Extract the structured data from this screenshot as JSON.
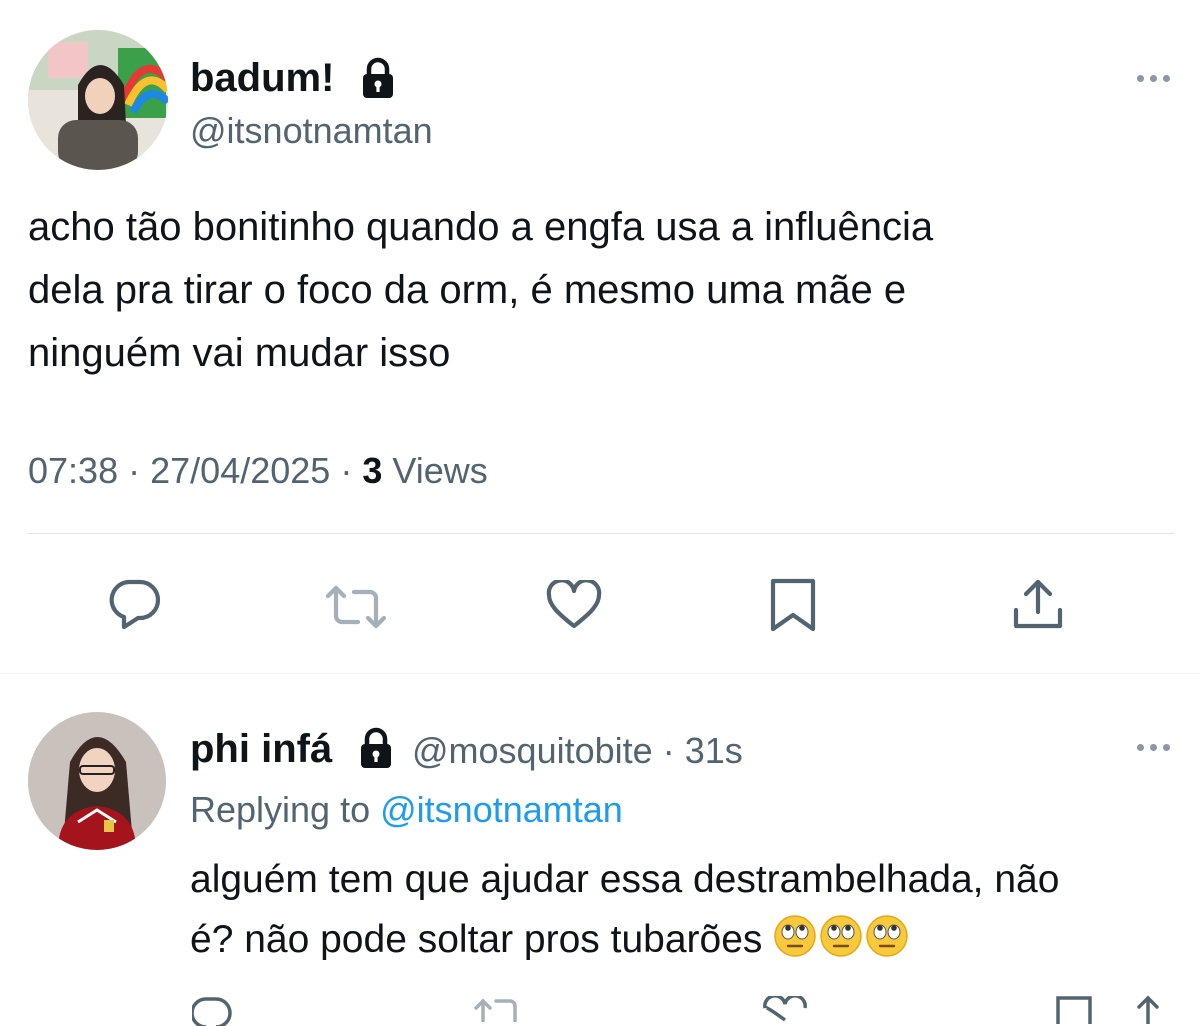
{
  "tweet": {
    "display_name": "badum!",
    "handle": "@itsnotnamtan",
    "text_lines": [
      "acho tão bonitinho quando a engfa usa a influência",
      "dela pra tirar o foco da orm, é mesmo uma mãe e",
      "ninguém vai mudar isso"
    ],
    "time": "07:38",
    "sep1": "·",
    "date": "27/04/2025",
    "sep2": "·",
    "views_count": "3",
    "views_label": "Views"
  },
  "reply": {
    "display_name": "phi infá",
    "handle": "@mosquitobite",
    "sep": "·",
    "age": "31s",
    "replying_prefix": "Replying to",
    "replying_handle": "@itsnotnamtan",
    "text_line1": "alguém tem que ajudar essa destrambelhada, não",
    "text_line2": "é? não pode soltar pros tubarões",
    "emoji_icon": "face-with-rolling-eyes"
  },
  "colors": {
    "primary_text": "#0f1419",
    "secondary_text": "#536471",
    "link": "#1d9bf0",
    "divider": "#e1e4e8",
    "icon": "#536471"
  }
}
